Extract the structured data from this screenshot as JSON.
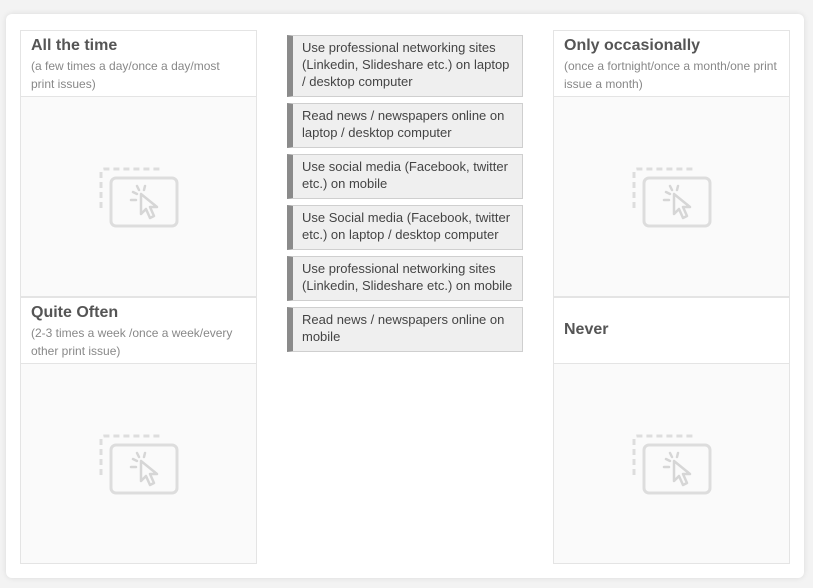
{
  "buckets": {
    "all_the_time": {
      "title": "All the time",
      "subtitle": "(a few times a day/once a day/most print issues)"
    },
    "quite_often": {
      "title": "Quite Often",
      "subtitle": "(2-3 times a week /once a week/every other print issue)"
    },
    "only_occasionally": {
      "title": "Only occasionally",
      "subtitle": "(once a fortnight/once a month/one print issue a month)"
    },
    "never": {
      "title": "Never",
      "subtitle": ""
    }
  },
  "items": [
    {
      "label": "Use professional networking sites (Linkedin, Slideshare etc.) on laptop / desktop computer"
    },
    {
      "label": "Read news / newspapers online on laptop / desktop computer"
    },
    {
      "label": "Use social media (Facebook, twitter etc.) on mobile"
    },
    {
      "label": "Use Social media (Facebook, twitter etc.) on laptop / desktop computer"
    },
    {
      "label": "Use professional networking sites (Linkedin, Slideshare etc.) on mobile"
    },
    {
      "label": "Read news / newspapers online on mobile"
    }
  ],
  "icons": {
    "drop_target": "drag-and-drop-cursor-icon"
  },
  "colors": {
    "item_accent": "#8a8a8a",
    "item_background": "#efefef",
    "title_text": "#555555"
  }
}
